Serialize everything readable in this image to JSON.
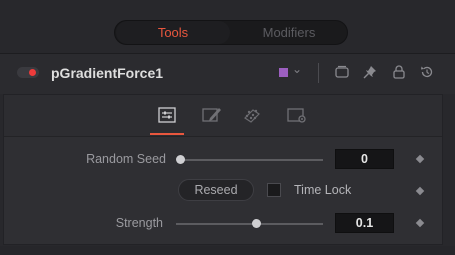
{
  "tabs": {
    "tools": "Tools",
    "modifiers": "Modifiers",
    "active": "Tools"
  },
  "header": {
    "node_name": "pGradientForce1",
    "enabled": true,
    "color": "#9c5fc0",
    "icons": [
      "color-swatch-dropdown",
      "version-icon",
      "pin-icon",
      "lock-icon",
      "reset-icon"
    ]
  },
  "inspector_tabs": {
    "icons": [
      "controls-tab-icon",
      "edit-tab-icon",
      "region-tab-icon",
      "settings-tab-icon"
    ],
    "active": "controls-tab-icon"
  },
  "controls": {
    "random_seed": {
      "label": "Random Seed",
      "value": "0",
      "slider_fraction": 0.0
    },
    "reseed_button": "Reseed",
    "time_lock": {
      "label": "Time Lock",
      "checked": false
    },
    "strength": {
      "label": "Strength",
      "value": "0.1",
      "slider_fraction": 0.55
    }
  },
  "colors": {
    "accent": "#e9573e",
    "enabled_dot": "#ee3b3b"
  }
}
